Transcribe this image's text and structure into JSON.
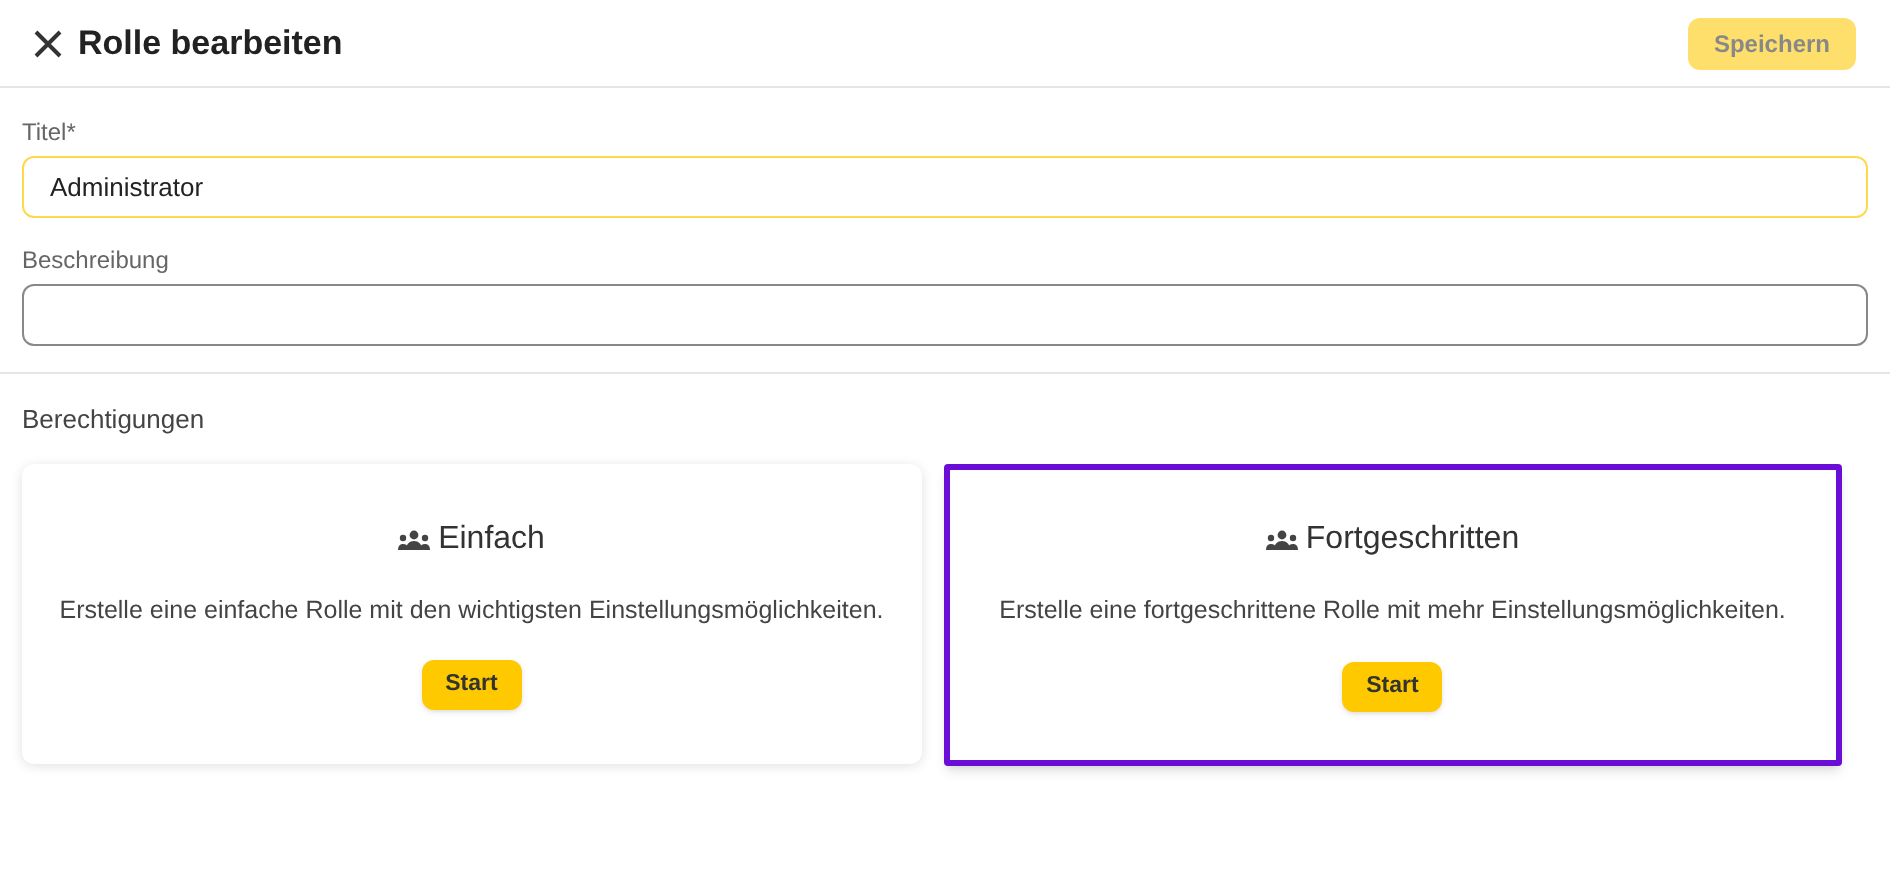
{
  "header": {
    "title": "Rolle bearbeiten",
    "save_button": {
      "label": "Speichern",
      "disabled": true
    }
  },
  "fields": [
    {
      "label": "Titel*",
      "value": "Administrator",
      "focused": true
    },
    {
      "label": "Beschreibung",
      "focused": false
    }
  ],
  "permissions": {
    "heading": "Berechtigungen",
    "options": [
      {
        "title": "Einfach",
        "description": "Erstelle eine einfache Rolle mit den wichtigsten Einstellungsmöglichkeiten.",
        "button": "Start",
        "selected": false
      },
      {
        "title": "Fortgeschritten",
        "description": "Erstelle eine fortgeschrittene Rolle mit mehr Einstellungsmöglichkeiten.",
        "button": "Start",
        "selected": true
      }
    ]
  }
}
